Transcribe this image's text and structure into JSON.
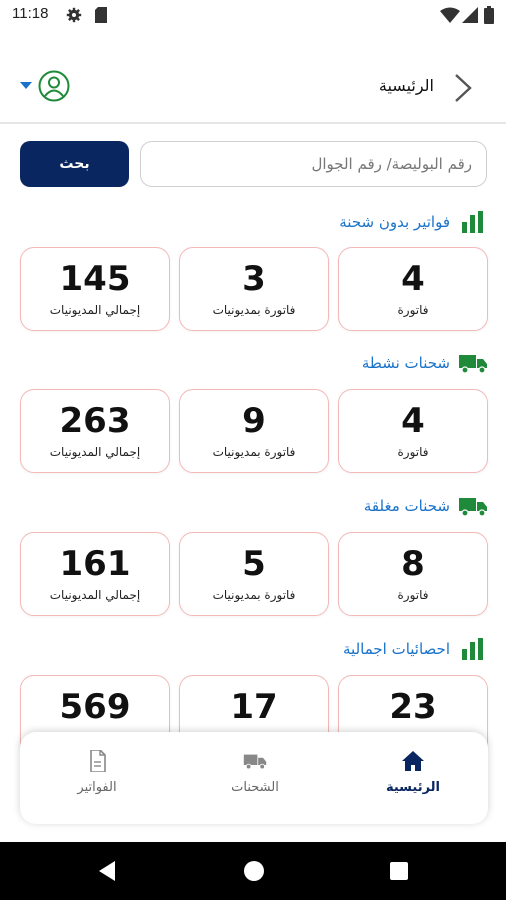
{
  "status_bar": {
    "time": "11:18"
  },
  "header": {
    "title": "الرئيسية"
  },
  "search": {
    "placeholder": "رقم البوليصة/ رقم الجوال",
    "button_label": "بحث"
  },
  "colors": {
    "accent": "#1a73c9",
    "primary": "#0a2660",
    "card_border": "#f3b9b9",
    "icon_green": "#1f8a3a"
  },
  "sections": [
    {
      "title": "فواتير بدون شحنة",
      "icon": "bar-chart-icon",
      "cards": [
        {
          "value": "4",
          "label": "فاتورة"
        },
        {
          "value": "3",
          "label": "فاتورة بمديونيات"
        },
        {
          "value": "145",
          "label": "إجمالي المديونيات"
        }
      ]
    },
    {
      "title": "شحنات نشطة",
      "icon": "truck-icon",
      "cards": [
        {
          "value": "4",
          "label": "فاتورة"
        },
        {
          "value": "9",
          "label": "فاتورة بمديونيات"
        },
        {
          "value": "263",
          "label": "إجمالي المديونيات"
        }
      ]
    },
    {
      "title": "شحنات مغلقة",
      "icon": "truck-icon",
      "cards": [
        {
          "value": "8",
          "label": "فاتورة"
        },
        {
          "value": "5",
          "label": "فاتورة بمديونيات"
        },
        {
          "value": "161",
          "label": "إجمالي المديونيات"
        }
      ]
    },
    {
      "title": "احصائيات اجمالية",
      "icon": "bar-chart-icon",
      "cards": [
        {
          "value": "23",
          "label": ""
        },
        {
          "value": "17",
          "label": ""
        },
        {
          "value": "569",
          "label": ""
        }
      ]
    }
  ],
  "bottom_nav": [
    {
      "label": "الرئيسية",
      "icon": "home-icon",
      "active": true
    },
    {
      "label": "الشحنات",
      "icon": "truck-icon",
      "active": false
    },
    {
      "label": "الفواتير",
      "icon": "invoice-icon",
      "active": false
    }
  ]
}
